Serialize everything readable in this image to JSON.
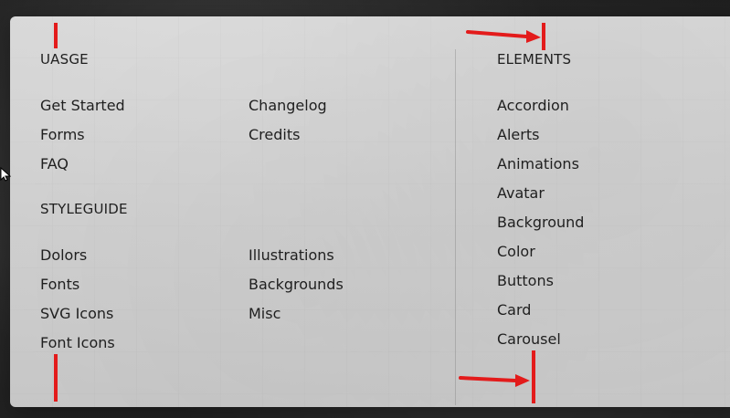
{
  "menu": {
    "left": {
      "title": "UASGE",
      "items": [
        "Get Started",
        "Forms",
        "FAQ",
        "Changelog",
        "Credits"
      ],
      "styleguide_title": "STYLEGUIDE",
      "styleguide_items": [
        "Dolors",
        "Fonts",
        "SVG Icons",
        "Font Icons",
        "Illustrations",
        "Backgrounds",
        "Misc"
      ]
    },
    "right": {
      "title": "ELEMENTS",
      "items": [
        "Accordion",
        "Alerts",
        "Animations",
        "Avatar",
        "Background",
        "Color",
        "Buttons",
        "Card",
        "Carousel"
      ]
    }
  },
  "annotations": {
    "color": "#e31b1b"
  }
}
